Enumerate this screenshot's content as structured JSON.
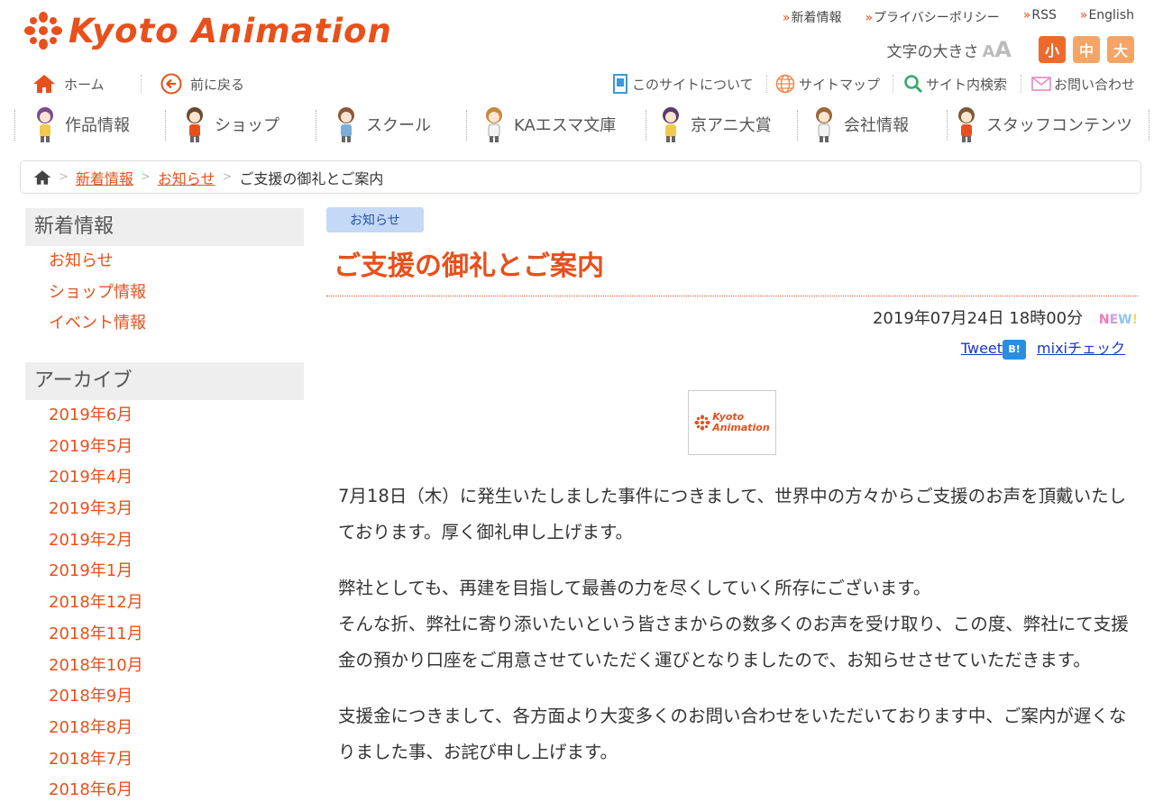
{
  "header": {
    "logo_text": "Kyoto Animation",
    "top_links": [
      "新着情報",
      "プライバシーポリシー",
      "RSS",
      "English"
    ],
    "font_size_label": "文字の大きさ",
    "font_sizes": [
      "小",
      "中",
      "大"
    ]
  },
  "subnav": {
    "home": "ホーム",
    "back": "前に戻る",
    "about": "このサイトについて",
    "sitemap": "サイトマップ",
    "search": "サイト内検索",
    "contact": "お問い合わせ"
  },
  "mainnav": [
    "作品情報",
    "ショップ",
    "スクール",
    "KAエスマ文庫",
    "京アニ大賞",
    "会社情報",
    "スタッフコンテンツ"
  ],
  "breadcrumb": [
    "新着情報",
    "お知らせ",
    "ご支援の御礼とご案内"
  ],
  "sidebar": {
    "news_title": "新着情報",
    "news_items": [
      "お知らせ",
      "ショップ情報",
      "イベント情報"
    ],
    "archive_title": "アーカイブ",
    "archive_items": [
      "2019年6月",
      "2019年5月",
      "2019年4月",
      "2019年3月",
      "2019年2月",
      "2019年1月",
      "2018年12月",
      "2018年11月",
      "2018年10月",
      "2018年9月",
      "2018年8月",
      "2018年7月",
      "2018年6月"
    ]
  },
  "article": {
    "category": "お知らせ",
    "title": "ご支援の御礼とご案内",
    "date": "2019年07月24日 18時00分",
    "new_badge": "NEW!",
    "tweet": "Tweet",
    "hatena": "B!",
    "mixi": "mixiチェック",
    "thumb_text_1": "Kyoto",
    "thumb_text_2": "Animation",
    "paragraphs": [
      "7月18日（木）に発生いたしました事件につきまして、世界中の方々からご支援のお声を頂戴いたしております。厚く御礼申し上げます。",
      "弊社としても、再建を目指して最善の力を尽くしていく所存にございます。",
      "そんな折、弊社に寄り添いたいという皆さまからの数多くのお声を受け取り、この度、弊社にて支援金の預かり口座をご用意させていただく運びとなりましたので、お知らせさせていただきます。",
      "支援金につきまして、各方面より大変多くのお問い合わせをいただいております中、ご案内が遅くなりました事、お詫び申し上げます。"
    ]
  },
  "colors": {
    "accent": "#e8501b",
    "category_bg": "#c4d9f5",
    "link_blue": "#1a35c8"
  }
}
